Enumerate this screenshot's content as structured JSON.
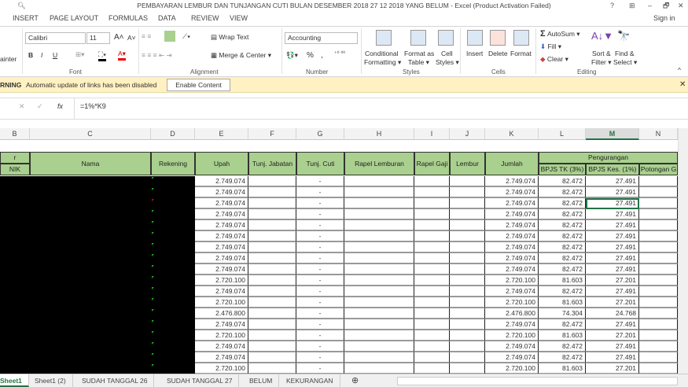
{
  "title": "PEMBAYARAN LEMBUR DAN TUNJANGAN CUTI BULAN DESEMBER 2018 27 12 2018 YANG BELUM - Excel (Product Activation Failed)",
  "window": {
    "help": "?",
    "restore_ribbon": "⊞",
    "minimize": "–",
    "maximize": "🗗",
    "close": "✕",
    "sign_in": "Sign in"
  },
  "tabs": [
    "INSERT",
    "PAGE LAYOUT",
    "FORMULAS",
    "DATA",
    "REVIEW",
    "VIEW"
  ],
  "ribbon": {
    "painter": "ainter",
    "font_name": "Calibri",
    "font_size": "11",
    "bold": "B",
    "italic": "I",
    "underline": "U",
    "wrap_text": "Wrap Text",
    "merge_center": "Merge & Center",
    "number_format": "Accounting",
    "percent": "%",
    "comma": ",",
    "conditional": "Conditional",
    "formatting": "Formatting ▾",
    "format_as": "Format as",
    "table": "Table ▾",
    "cell": "Cell",
    "styles_btn": "Styles ▾",
    "insert": "Insert",
    "delete": "Delete",
    "format": "Format",
    "autosum": "AutoSum ▾",
    "fill": "Fill ▾",
    "clear": "Clear ▾",
    "sort": "Sort &",
    "filter": "Filter ▾",
    "find": "Find &",
    "select": "Select ▾",
    "groups": {
      "font": "Font",
      "alignment": "Alignment",
      "number": "Number",
      "styles": "Styles",
      "cells": "Cells",
      "editing": "Editing"
    }
  },
  "warning": {
    "label": "RNING",
    "message": "Automatic update of links has been disabled",
    "button": "Enable Content",
    "close": "✕"
  },
  "formula_bar": {
    "cancel": "✕",
    "enter": "✓",
    "fx": "fx",
    "formula": "=1%*K9"
  },
  "columns": [
    "B",
    "C",
    "D",
    "E",
    "F",
    "G",
    "H",
    "I",
    "J",
    "K",
    "L",
    "M",
    "N"
  ],
  "headers": {
    "b_top": "r",
    "nik": "NIK",
    "nama": "Nama",
    "rekening": "Rekening",
    "upah": "Upah",
    "tunj_jabatan": "Tunj. Jabatan",
    "tunj_cuti": "Tunj. Cuti",
    "rapel_lembur": "Rapel Lemburan",
    "rapel_gaji": "Rapel Gaji",
    "lembur": "Lembur",
    "jumlah": "Jumlah",
    "pengurangan": "Pengurangan",
    "bpjs_tk": "BPJS TK (3%)",
    "bpjs_kes": "BPJS Kes. (1%)",
    "potongan": "Potongan G"
  },
  "rows": [
    {
      "upah": "2.749.074",
      "cuti": "-",
      "jumlah": "2.749.074",
      "tk": "82.472",
      "kes": "27.491"
    },
    {
      "upah": "2.749.074",
      "cuti": "-",
      "jumlah": "2.749.074",
      "tk": "82.472",
      "kes": "27.491"
    },
    {
      "upah": "2.749.074",
      "cuti": "-",
      "jumlah": "2.749.074",
      "tk": "82.472",
      "kes": "27.491"
    },
    {
      "upah": "2.749.074",
      "cuti": "-",
      "jumlah": "2.749.074",
      "tk": "82.472",
      "kes": "27.491"
    },
    {
      "upah": "2.749.074",
      "cuti": "-",
      "jumlah": "2.749.074",
      "tk": "82.472",
      "kes": "27.491"
    },
    {
      "upah": "2.749.074",
      "cuti": "-",
      "jumlah": "2.749.074",
      "tk": "82.472",
      "kes": "27.491"
    },
    {
      "upah": "2.749.074",
      "cuti": "-",
      "jumlah": "2.749.074",
      "tk": "82.472",
      "kes": "27.491"
    },
    {
      "upah": "2.749.074",
      "cuti": "-",
      "jumlah": "2.749.074",
      "tk": "82.472",
      "kes": "27.491"
    },
    {
      "upah": "2.749.074",
      "cuti": "-",
      "jumlah": "2.749.074",
      "tk": "82.472",
      "kes": "27.491"
    },
    {
      "upah": "2.720.100",
      "cuti": "-",
      "jumlah": "2.720.100",
      "tk": "81.603",
      "kes": "27.201"
    },
    {
      "upah": "2.749.074",
      "cuti": "-",
      "jumlah": "2.749.074",
      "tk": "82.472",
      "kes": "27.491"
    },
    {
      "upah": "2.720.100",
      "cuti": "-",
      "jumlah": "2.720.100",
      "tk": "81.603",
      "kes": "27.201"
    },
    {
      "upah": "2.476.800",
      "cuti": "-",
      "jumlah": "2.476.800",
      "tk": "74.304",
      "kes": "24.768"
    },
    {
      "upah": "2.749.074",
      "cuti": "-",
      "jumlah": "2.749.074",
      "tk": "82.472",
      "kes": "27.491"
    },
    {
      "upah": "2.720.100",
      "cuti": "-",
      "jumlah": "2.720.100",
      "tk": "81.603",
      "kes": "27.201"
    },
    {
      "upah": "2.749.074",
      "cuti": "-",
      "jumlah": "2.749.074",
      "tk": "82.472",
      "kes": "27.491"
    },
    {
      "upah": "2.749.074",
      "cuti": "-",
      "jumlah": "2.749.074",
      "tk": "82.472",
      "kes": "27.491"
    },
    {
      "upah": "2.720.100",
      "cuti": "-",
      "jumlah": "2.720.100",
      "tk": "81.603",
      "kes": "27.201"
    }
  ],
  "sheets": [
    "Sheet1",
    "Sheet1 (2)",
    "SUDAH TANGGAL 26",
    "SUDAH TANGGAL 27",
    "BELUM",
    "KEKURANGAN"
  ],
  "add_sheet": "⊕",
  "colors": {
    "header_green": "#a9d08e",
    "warning_bg": "#fff1c2",
    "excel_green": "#217346"
  }
}
